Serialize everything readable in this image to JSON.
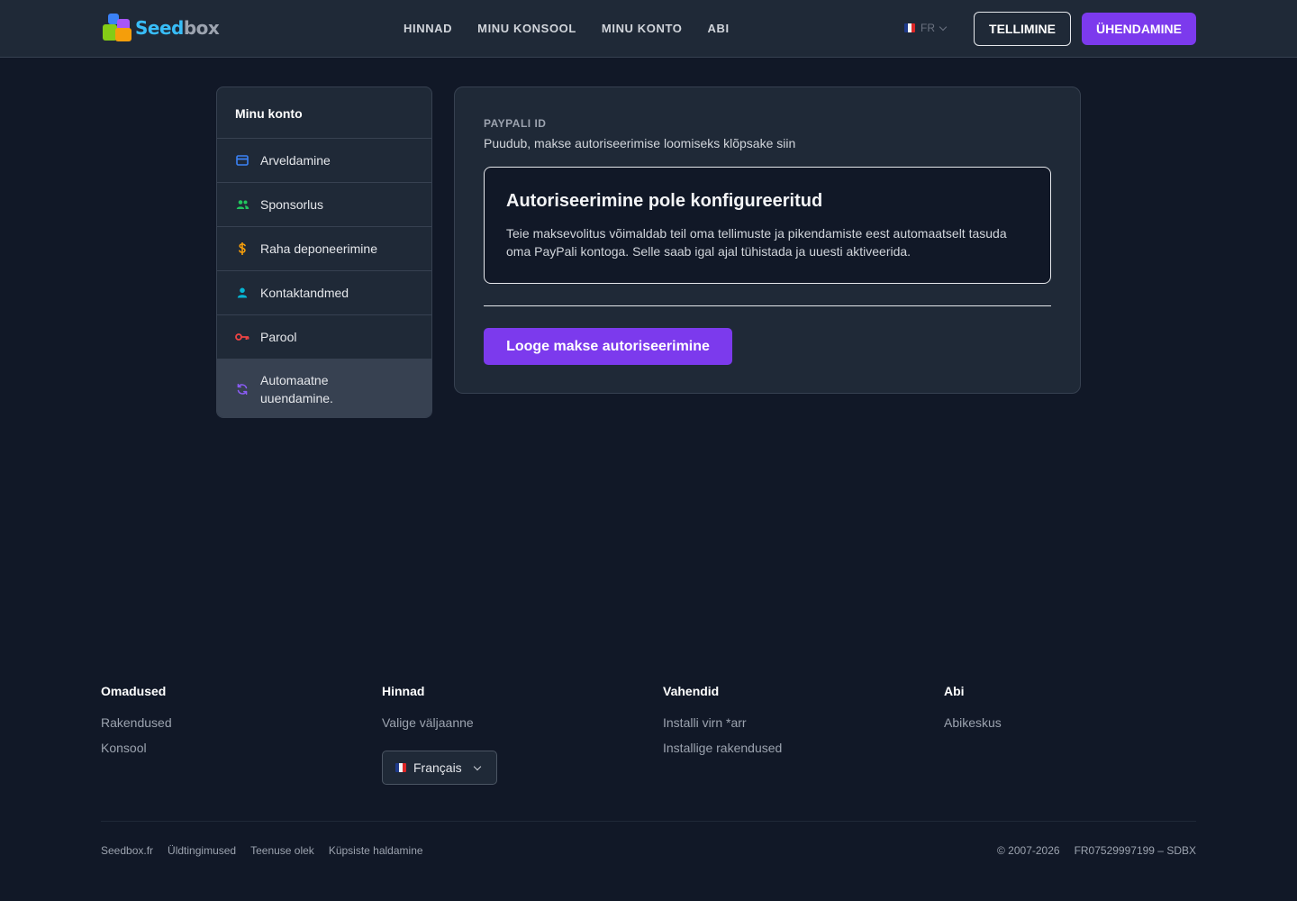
{
  "header": {
    "logo": {
      "seed": "Seed",
      "box": "box"
    },
    "nav": [
      "HINNAD",
      "MINU KONSOOL",
      "MINU KONTO",
      "ABI"
    ],
    "lang_code": "FR",
    "order_label": "TELLIMINE",
    "connect_label": "ÜHENDAMINE"
  },
  "sidebar": {
    "title": "Minu konto",
    "items": [
      {
        "label": "Arveldamine",
        "icon": "credit-card-icon",
        "color": "#3b82f6"
      },
      {
        "label": "Sponsorlus",
        "icon": "users-icon",
        "color": "#22c55e"
      },
      {
        "label": "Raha deponeerimine",
        "icon": "dollar-icon",
        "color": "#f59e0b"
      },
      {
        "label": "Kontaktandmed",
        "icon": "user-icon",
        "color": "#06b6d4"
      },
      {
        "label": "Parool",
        "icon": "key-icon",
        "color": "#ef4444"
      },
      {
        "label": "Automaatne uuendamine.",
        "icon": "refresh-icon",
        "color": "#8b5cf6",
        "active": true
      }
    ]
  },
  "main": {
    "paypal_label": "PAYPALI ID",
    "paypal_value": "Puudub, makse autoriseerimise loomiseks klõpsake siin",
    "alert_title": "Autoriseerimine pole konfigureeritud",
    "alert_text": "Teie maksevolitus võimaldab teil oma tellimuste ja pikendamiste eest automaatselt tasuda oma PayPali kontoga. Selle saab igal ajal tühistada ja uuesti aktiveerida.",
    "create_button": "Looge makse autoriseerimine"
  },
  "footer": {
    "columns": [
      {
        "title": "Omadused",
        "links": [
          "Rakendused",
          "Konsool"
        ]
      },
      {
        "title": "Hinnad",
        "links": [
          "Valige väljaanne"
        ]
      },
      {
        "title": "Vahendid",
        "links": [
          "Installi virn *arr",
          "Installige rakendused"
        ]
      },
      {
        "title": "Abi",
        "links": [
          "Abikeskus"
        ]
      }
    ],
    "language": "Français",
    "bottom_links": [
      "Seedbox.fr",
      "Üldtingimused",
      "Teenuse olek",
      "Küpsiste haldamine"
    ],
    "copyright": "© 2007-2026",
    "company_id": "FR07529997199 – SDBX"
  },
  "colors": {
    "accent": "#7c3aed",
    "background": "#111827",
    "surface": "#1f2937"
  }
}
